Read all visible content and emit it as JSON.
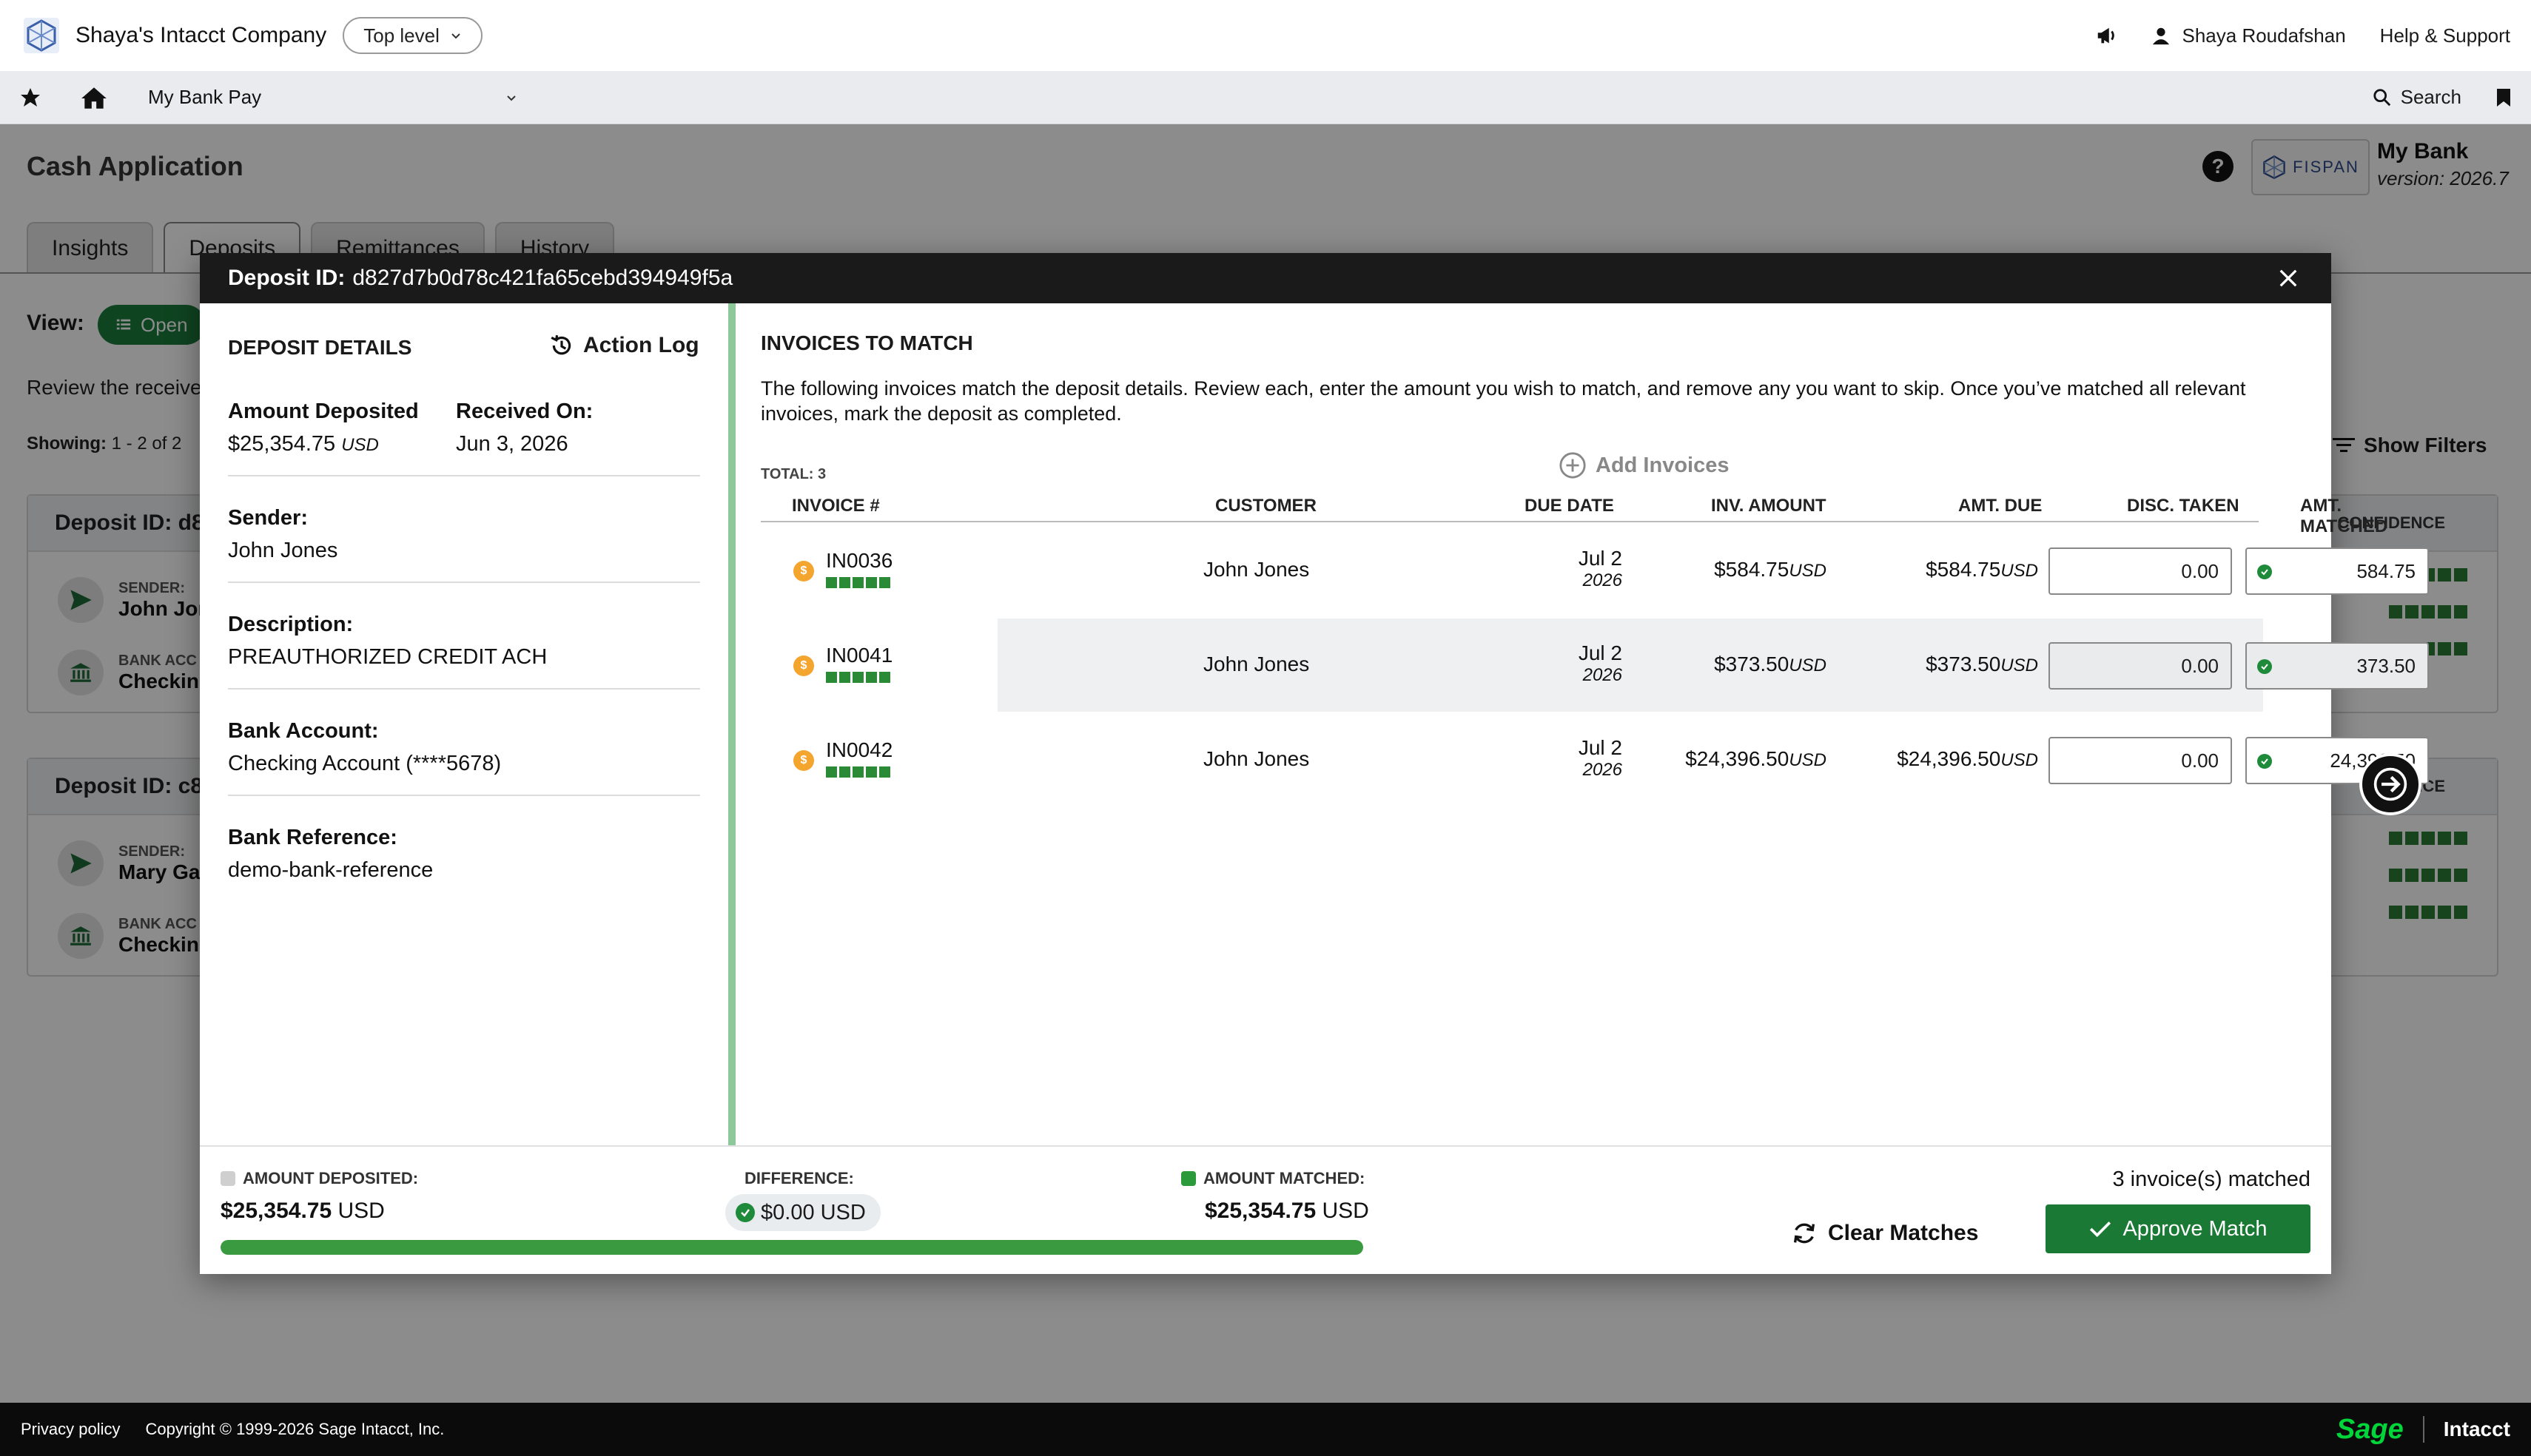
{
  "header": {
    "company": "Shaya's Intacct Company",
    "level": "Top level",
    "user": "Shaya Roudafshan",
    "help": "Help & Support"
  },
  "nav": {
    "app": "My Bank Pay",
    "search": "Search"
  },
  "page": {
    "title": "Cash Application",
    "bank_name": "My Bank",
    "bank_version": "version: 2026.7",
    "fispan_logo": "FISPAN",
    "tabs": [
      "Insights",
      "Deposits",
      "Remittances",
      "History"
    ],
    "view_label": "View:",
    "view_value": "Open",
    "review_text": "Review the receive",
    "showing_label": "Showing:",
    "showing_value": "1 - 2 of 2",
    "show_filters": "Show Filters",
    "cards": [
      {
        "id_label": "Deposit ID: d8",
        "sender_label": "SENDER:",
        "sender": "John Jor",
        "bank_label": "BANK ACC",
        "bank": "Checkin",
        "confidence_label": "CONFIDENCE"
      },
      {
        "id_label": "Deposit ID: c8",
        "sender_label": "SENDER:",
        "sender": "Mary Ga",
        "bank_label": "BANK ACC",
        "bank": "Checkin",
        "confidence_label": "IDENCE"
      }
    ]
  },
  "modal": {
    "id_label": "Deposit ID:",
    "id_value": "d827d7b0d78c421fa65cebd394949f5a",
    "left": {
      "title": "DEPOSIT DETAILS",
      "action_log": "Action Log",
      "amount_label": "Amount Deposited",
      "amount_value": "$25,354.75",
      "amount_currency": "USD",
      "received_label": "Received On:",
      "received_value": "Jun 3, 2026",
      "sender_label": "Sender:",
      "sender_value": "John Jones",
      "desc_label": "Description:",
      "desc_value": "PREAUTHORIZED CREDIT ACH",
      "bank_label": "Bank Account:",
      "bank_value": "Checking Account (****5678)",
      "ref_label": "Bank Reference:",
      "ref_value": "demo-bank-reference"
    },
    "right": {
      "title": "INVOICES TO MATCH",
      "description": "The following invoices match the deposit details. Review each, enter the amount you wish to match, and remove any you want to skip. Once you’ve matched all relevant invoices, mark the deposit as completed.",
      "total": "TOTAL: 3",
      "add_invoices": "Add Invoices",
      "columns": {
        "invoice": "INVOICE #",
        "customer": "CUSTOMER",
        "due": "DUE DATE",
        "inv_amount": "INV. AMOUNT",
        "amt_due": "AMT. DUE",
        "disc": "DISC. TAKEN",
        "matched": "AMT. MATCHED"
      },
      "rows": [
        {
          "invoice": "IN0036",
          "customer": "John Jones",
          "due_md": "Jul 2",
          "due_y": "2026",
          "inv_amount": "$584.75",
          "amt_due": "$584.75",
          "currency": "USD",
          "disc": "0.00",
          "matched": "584.75"
        },
        {
          "invoice": "IN0041",
          "customer": "John Jones",
          "due_md": "Jul 2",
          "due_y": "2026",
          "inv_amount": "$373.50",
          "amt_due": "$373.50",
          "currency": "USD",
          "disc": "0.00",
          "matched": "373.50"
        },
        {
          "invoice": "IN0042",
          "customer": "John Jones",
          "due_md": "Jul 2",
          "due_y": "2026",
          "inv_amount": "$24,396.50",
          "amt_due": "$24,396.50",
          "currency": "USD",
          "disc": "0.00",
          "matched": "24,396.50"
        }
      ]
    },
    "summary": {
      "deposited_label": "AMOUNT DEPOSITED:",
      "deposited_value": "$25,354.75",
      "deposited_currency": "USD",
      "difference_label": "DIFFERENCE:",
      "difference_value": "$0.00",
      "difference_currency": "USD",
      "matched_label": "AMOUNT MATCHED:",
      "matched_value": "$25,354.75",
      "matched_currency": "USD",
      "matched_fraction": 1.0,
      "matched_count": "3 invoice(s) matched",
      "clear": "Clear Matches",
      "approve": "Approve Match"
    }
  },
  "footer": {
    "privacy": "Privacy policy",
    "copyright": "Copyright © 1999-2026 Sage Intacct, Inc.",
    "sage": "Sage",
    "intacct": "Intacct"
  },
  "colors": {
    "accent_green": "#1a7a35",
    "split_green": "#8cc89a",
    "coin_orange": "#f3a52e"
  }
}
